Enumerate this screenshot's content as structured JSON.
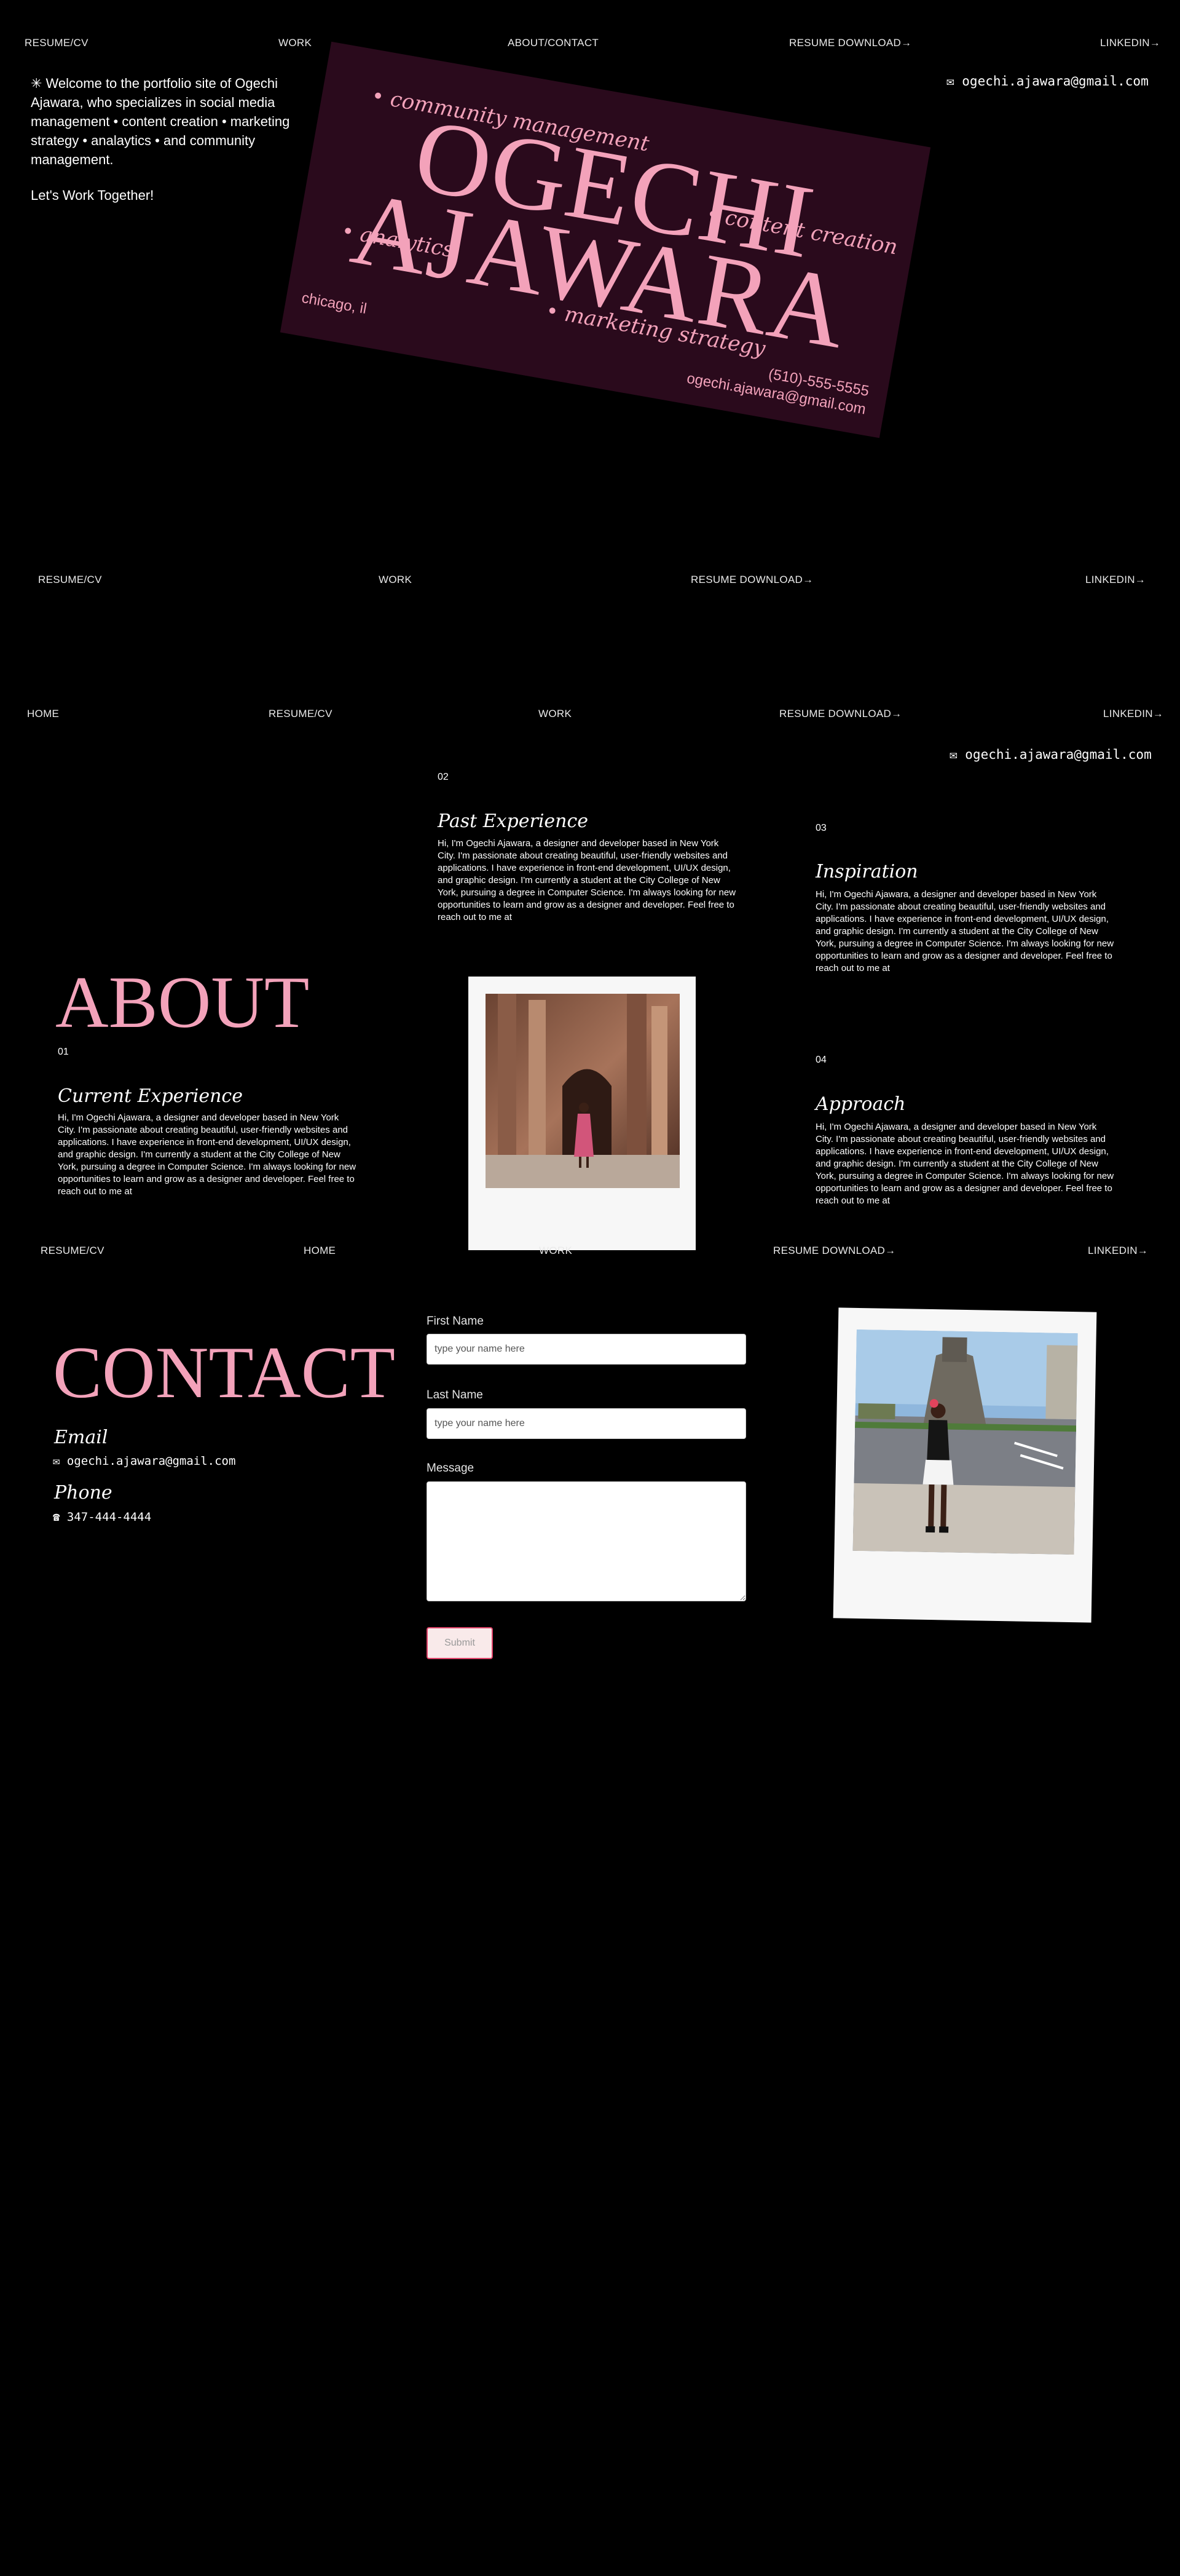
{
  "nav1": {
    "resume": "RESUME/CV",
    "work": "WORK",
    "about": "ABOUT/CONTACT",
    "download": "RESUME DOWNLOAD→",
    "linkedin": "LINKEDIN→"
  },
  "hero": {
    "email": "✉ ogechi.ajawara@gmail.com",
    "intro": "✳ Welcome to the portfolio site of Ogechi Ajawara, who specializes in social media management • content creation • marketing strategy • analaytics • and community management.",
    "cta": "Let's Work Together!",
    "card": {
      "first": "OGECHI",
      "last": "AJAWARA",
      "tag1": "• community management",
      "tag2": "• content creation",
      "tag3": "• analytics",
      "tag4": "• marketing strategy",
      "city": "chicago, il",
      "phone": "(510)-555-5555",
      "email": "ogechi.ajawara@gmail.com"
    }
  },
  "nav2": {
    "resume": "RESUME/CV",
    "work": "WORK",
    "download": "RESUME DOWNLOAD→",
    "linkedin": "LINKEDIN→"
  },
  "nav3": {
    "home": "HOME",
    "resume": "RESUME/CV",
    "work": "WORK",
    "download": "RESUME DOWNLOAD→",
    "linkedin": "LINKEDIN→"
  },
  "about": {
    "email": "✉ ogechi.ajawara@gmail.com",
    "title": "ABOUT",
    "sections": [
      {
        "num": "01",
        "heading": "Current Experience",
        "text": "Hi, I'm Ogechi Ajawara, a designer and developer based in New York City. I'm passionate about creating beautiful, user-friendly websites and applications. I have experience in front-end development, UI/UX design, and graphic design. I'm currently a student at the City College of New York, pursuing a degree in Computer Science. I'm always looking for new opportunities to learn and grow as a designer and developer. Feel free to reach out to me at"
      },
      {
        "num": "02",
        "heading": "Past Experience",
        "text": "Hi, I'm Ogechi Ajawara, a designer and developer based in New York City. I'm passionate about creating beautiful, user-friendly websites and applications. I have experience in front-end development, UI/UX design, and graphic design. I'm currently a student at the City College of New York, pursuing a degree in Computer Science. I'm always looking for new opportunities to learn and grow as a designer and developer. Feel free to reach out to me at"
      },
      {
        "num": "03",
        "heading": "Inspiration",
        "text": "Hi, I'm Ogechi Ajawara, a designer and developer based in New York City. I'm passionate about creating beautiful, user-friendly websites and applications. I have experience in front-end development, UI/UX design, and graphic design. I'm currently a student at the City College of New York, pursuing a degree in Computer Science. I'm always looking for new opportunities to learn and grow as a designer and developer. Feel free to reach out to me at"
      },
      {
        "num": "04",
        "heading": "Approach",
        "text": "Hi, I'm Ogechi Ajawara, a designer and developer based in New York City. I'm passionate about creating beautiful, user-friendly websites and applications. I have experience in front-end development, UI/UX design, and graphic design. I'm currently a student at the City College of New York, pursuing a degree in Computer Science. I'm always looking for new opportunities to learn and grow as a designer and developer. Feel free to reach out to me at"
      }
    ]
  },
  "nav4": {
    "resume": "RESUME/CV",
    "home": "HOME",
    "work": "WORK",
    "download": "RESUME DOWNLOAD→",
    "linkedin": "LINKEDIN→"
  },
  "contact": {
    "title": "CONTACT",
    "email_heading": "Email",
    "email": "✉ ogechi.ajawara@gmail.com",
    "phone_heading": "Phone",
    "phone": "☎ 347-444-4444",
    "form": {
      "first_label": "First Name",
      "first_placeholder": "type your name here",
      "last_label": "Last Name",
      "last_placeholder": "type your name here",
      "message_label": "Message",
      "submit": "Submit"
    }
  },
  "colors": {
    "background": "#000000",
    "accent": "#f3a2ba",
    "card": "#2a0a1c"
  }
}
